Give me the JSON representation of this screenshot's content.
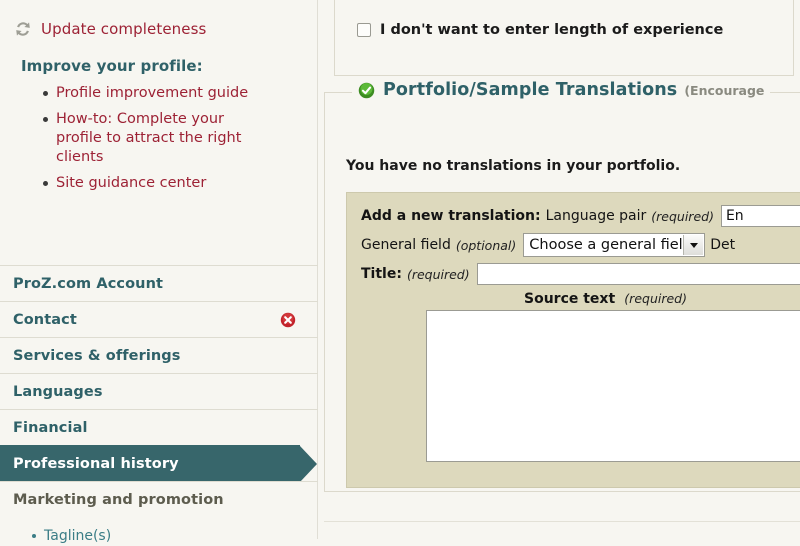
{
  "sidebar": {
    "update": {
      "icon": "refresh-icon",
      "label": "Update completeness"
    },
    "improve_heading": "Improve your profile:",
    "improve_links": [
      "Profile improvement guide",
      "How-to: Complete your profile to attract the right clients",
      "Site guidance center"
    ],
    "nav_items": [
      {
        "label": "ProZ.com Account",
        "state": "normal",
        "status": ""
      },
      {
        "label": "Contact",
        "state": "normal",
        "status": "error-icon"
      },
      {
        "label": "Services & offerings",
        "state": "normal",
        "status": ""
      },
      {
        "label": "Languages",
        "state": "normal",
        "status": ""
      },
      {
        "label": "Financial",
        "state": "normal",
        "status": ""
      },
      {
        "label": "Professional history",
        "state": "active",
        "status": ""
      },
      {
        "label": "Marketing and promotion",
        "state": "muted",
        "status": ""
      }
    ],
    "nav_sub_item": "Tagline(s)"
  },
  "main": {
    "experience": {
      "checkbox_label": "I don't want to enter length of experience",
      "checked": false
    },
    "portfolio": {
      "icon": "check-circle-icon",
      "title": "Portfolio/Sample Translations",
      "note": "(Encourage",
      "empty_message": "You have no translations in your portfolio.",
      "form": {
        "add_label": "Add a new translation:",
        "language_pair_label": "Language pair",
        "language_pair_required": "(required)",
        "language_pair_value": "En",
        "general_field_label": "General field",
        "general_field_optional": "(optional)",
        "general_field_value": "Choose a general field",
        "detailed_field_label": "Det",
        "title_label": "Title:",
        "title_required": "(required)",
        "title_value": "",
        "source_text_label": "Source text",
        "source_text_required": "(required)",
        "source_text_value": ""
      }
    }
  },
  "colors": {
    "page_bg": "#f7f6f1",
    "form_bg": "#ddd9bd",
    "teal": "#2f6168",
    "teal_active": "#37666b",
    "red_link": "#9d2235",
    "error_red": "#c2232b",
    "success_green": "#4aa32b"
  }
}
